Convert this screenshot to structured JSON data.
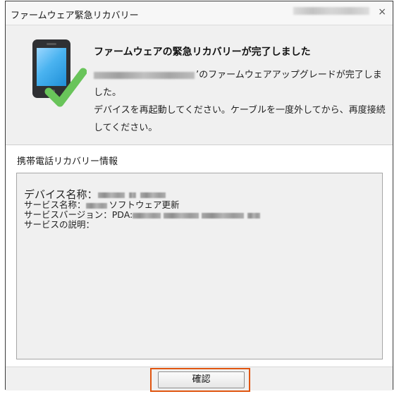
{
  "window": {
    "title": "ファームウェア緊急リカバリー",
    "close_glyph": "×"
  },
  "main": {
    "headline": "ファームウェアの緊急リカバリーが完了しました",
    "message_after_device": "’のファームウェアアップグレードが完了しました。",
    "message_rest": "デバイスを再起動してください。ケーブルを一度外してから、再度接続してください。"
  },
  "info": {
    "title": "携帯電話リカバリー情報",
    "device_name_label": "デバイス名称：",
    "service_name_label": "サービス名称：",
    "service_name_suffix": "ソフトウェア更新",
    "service_version_label": "サービスバージョン：PDA:",
    "service_description_label": "サービスの説明："
  },
  "buttons": {
    "confirm": "確認"
  },
  "icons": {
    "device": "phone-icon",
    "success": "check-icon"
  },
  "colors": {
    "check_green": "#69c45a",
    "highlight": "#e05510"
  }
}
